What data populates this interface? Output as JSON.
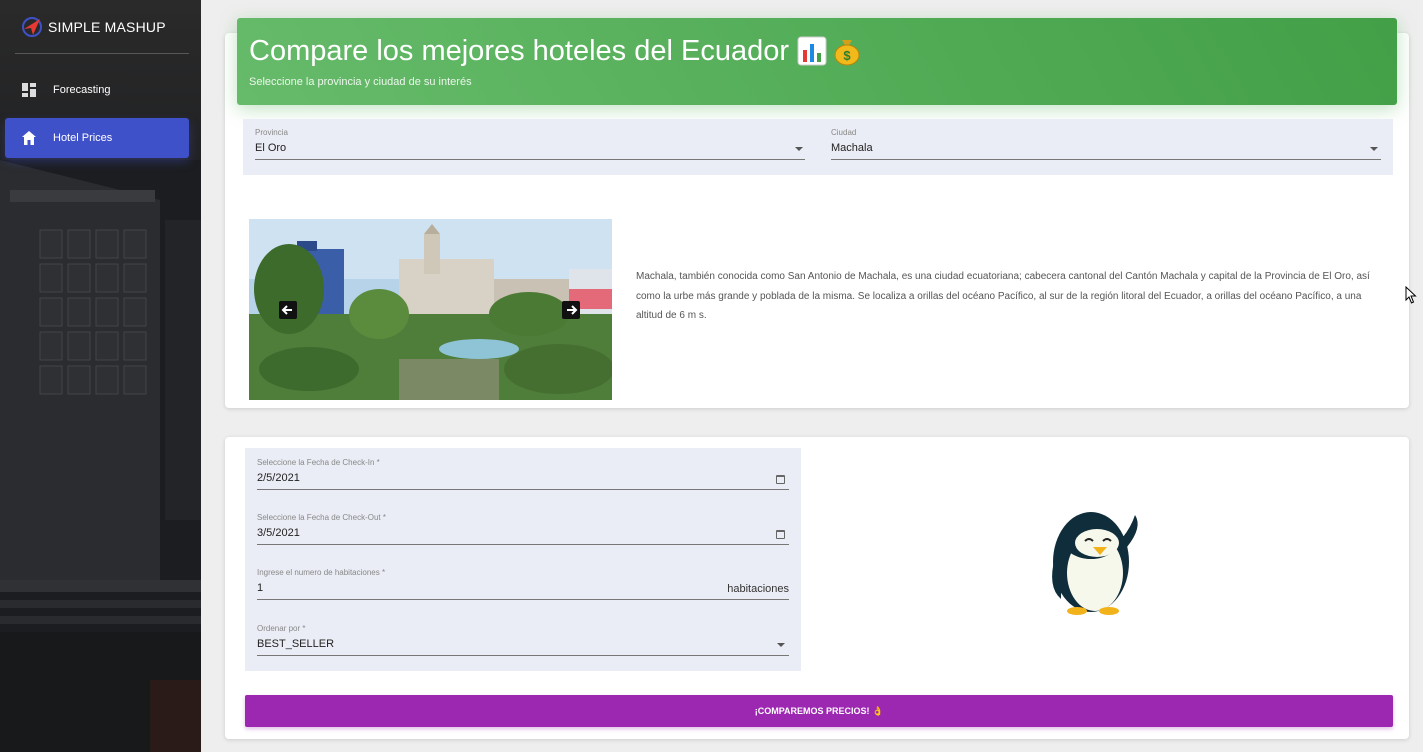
{
  "sidebar": {
    "brand": "SIMPLE MASHUP",
    "items": [
      {
        "label": "Forecasting",
        "icon": "dashboard-icon"
      },
      {
        "label": "Hotel Prices",
        "icon": "home-icon",
        "active": true
      }
    ]
  },
  "header": {
    "title": "Compare los mejores hoteles del Ecuador",
    "subtitle": "Seleccione la provincia y ciudad de su interés",
    "emojis": [
      "chart-emoji",
      "money-bag-emoji"
    ],
    "color": "#4caf50"
  },
  "location": {
    "provincia": {
      "label": "Provincia",
      "value": "El Oro"
    },
    "ciudad": {
      "label": "Ciudad",
      "value": "Machala"
    }
  },
  "city": {
    "description": "Machala, también conocida como San Antonio de Machala, es una ciudad ecuatoriana; cabecera cantonal del Cantón Machala y capital de la Provincia de El Oro, así como la urbe más grande y poblada de la misma. Se localiza a orillas del océano Pacífico, al sur de la región litoral del Ecuador, a orillas del océano Pacífico, a una altitud de 6 m s."
  },
  "form": {
    "checkin": {
      "label": "Seleccione la Fecha de Check-In *",
      "value": "2/5/2021"
    },
    "checkout": {
      "label": "Seleccione la Fecha de Check-Out *",
      "value": "3/5/2021"
    },
    "rooms": {
      "label": "Ingrese el numero de habitaciones *",
      "value": "1",
      "suffix": "habitaciones"
    },
    "order": {
      "label": "Ordenar por *",
      "value": "BEST_SELLER"
    }
  },
  "submit": {
    "label": "¡COMPAREMOS PRECIOS! 👌",
    "color": "#9c27b0"
  },
  "accent": {
    "nav_active": "#3f51c9"
  }
}
